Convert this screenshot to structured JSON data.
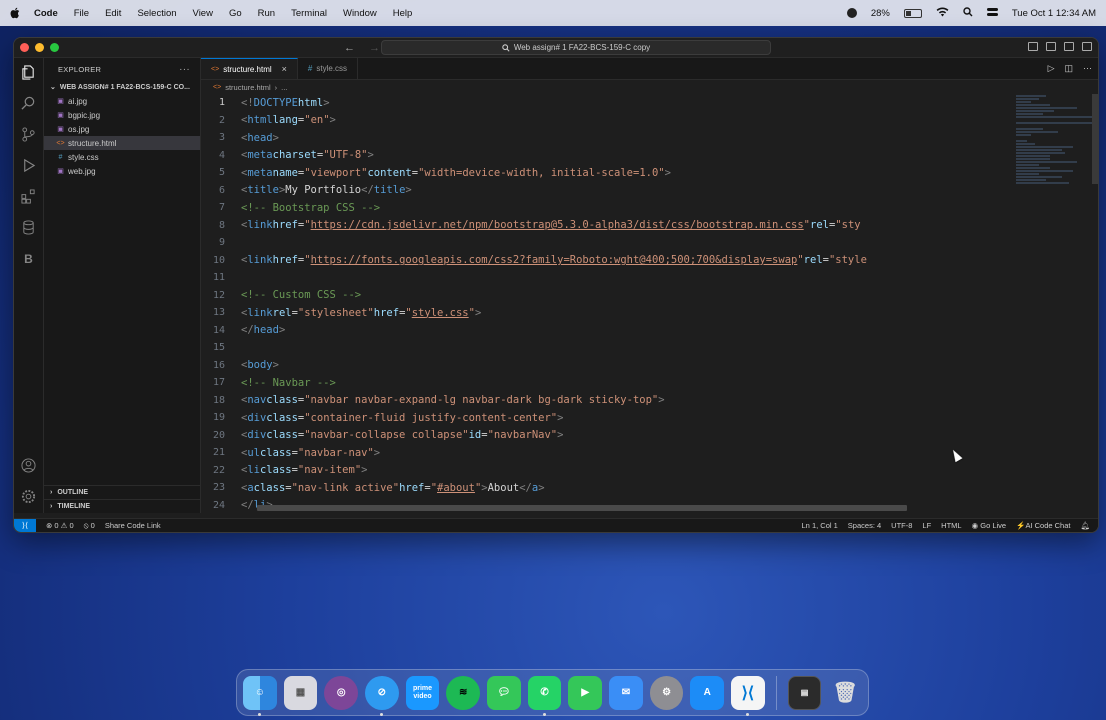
{
  "menubar": {
    "app_name": "Code",
    "items": [
      "File",
      "Edit",
      "Selection",
      "View",
      "Go",
      "Run",
      "Terminal",
      "Window",
      "Help"
    ],
    "battery": "28%",
    "datetime": "Tue Oct 1  12:34 AM"
  },
  "window": {
    "search_text": "Web assign# 1 FA22-BCS-159-C copy"
  },
  "sidebar": {
    "title": "EXPLORER",
    "folder": "WEB ASSIGN# 1 FA22-BCS-159-C CO...",
    "files": [
      {
        "name": "ai.jpg",
        "icon": "image-file-icon"
      },
      {
        "name": "bgpic.jpg",
        "icon": "image-file-icon"
      },
      {
        "name": "os.jpg",
        "icon": "image-file-icon"
      },
      {
        "name": "structure.html",
        "icon": "html-file-icon",
        "selected": true
      },
      {
        "name": "style.css",
        "icon": "css-file-icon"
      },
      {
        "name": "web.jpg",
        "icon": "image-file-icon"
      }
    ],
    "outline": "OUTLINE",
    "timeline": "TIMELINE"
  },
  "tabs": [
    {
      "label": "structure.html",
      "active": true
    },
    {
      "label": "style.css",
      "active": false
    }
  ],
  "breadcrumb": {
    "file": "structure.html",
    "rest": "..."
  },
  "statusbar": {
    "errors": "0",
    "warnings": "0",
    "ports": "0",
    "share": "Share Code Link",
    "position": "Ln 1, Col 1",
    "spaces": "Spaces: 4",
    "encoding": "UTF-8",
    "eol": "LF",
    "language": "HTML",
    "golive": "Go Live",
    "aichat": "AI Code Chat"
  },
  "colors": {
    "accent": "#0078d4",
    "tag": "#569cd6",
    "attr": "#9cdcfe",
    "string": "#ce9178",
    "comment": "#6a9955"
  },
  "dock_apps": [
    "Finder",
    "Launchpad",
    "Tor Browser",
    "Safari",
    "Prime Video",
    "Spotify",
    "Messages",
    "WhatsApp",
    "FaceTime",
    "Mail",
    "System Settings",
    "App Store",
    "Visual Studio Code",
    "Terminal",
    "Trash"
  ]
}
